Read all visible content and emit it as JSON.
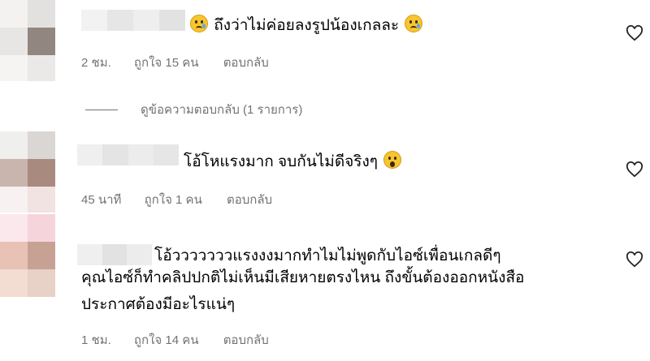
{
  "comments": [
    {
      "text": "ถึงว่าไม่ค่อยลงรูปน้องเกลละ",
      "time": "2 ชม.",
      "likes": "ถูกใจ 15 คน",
      "reply": "ตอบกลับ",
      "view_replies": "ดูข้อความตอบกลับ (1 รายการ)"
    },
    {
      "text": "โอ้โหแรงมาก จบกันไม่ดีจริงๆ",
      "time": "45 นาที",
      "likes": "ถูกใจ 1 คน",
      "reply": "ตอบกลับ"
    },
    {
      "text_lines": [
        "โอ้วววววววแรงงงมากทำไมไม่พูดกับไอซ์เพื่อนเกลดีๆ",
        "คุณไอซ์ก็ทำคลิปปกติไม่เห็นมีเสียหายตรงไหน ถึงขั้นต้องออกหนังสือ",
        "ประกาศต้องมีอะไรแน่ๆ"
      ],
      "time": "1 ชม.",
      "likes": "ถูกใจ 14 คน",
      "reply": "ตอบกลับ"
    }
  ],
  "icons": [
    "heart-icon",
    "crying-face-emoji",
    "surprised-face-emoji"
  ],
  "colors": {
    "meta_text": "#737373",
    "text": "#000000",
    "background": "#ffffff"
  }
}
